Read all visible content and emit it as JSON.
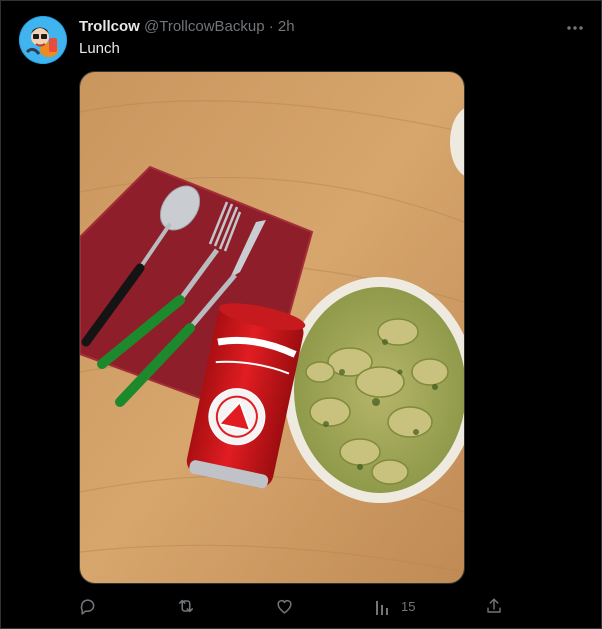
{
  "tweet": {
    "display_name": "Trollcow",
    "handle": "@TrollcowBackup",
    "separator": "·",
    "time": "2h",
    "text": "Lunch",
    "views": "15"
  },
  "icons": {
    "avatar": "cartoon-avatar",
    "more": "more-horizontal-icon",
    "reply": "reply-icon",
    "retweet": "retweet-icon",
    "like": "heart-icon",
    "views": "views-bar-chart-icon",
    "share": "share-icon"
  },
  "colors": {
    "background": "#000000",
    "text": "#e7e9ea",
    "secondary": "#71767b",
    "border": "#2f3336"
  }
}
